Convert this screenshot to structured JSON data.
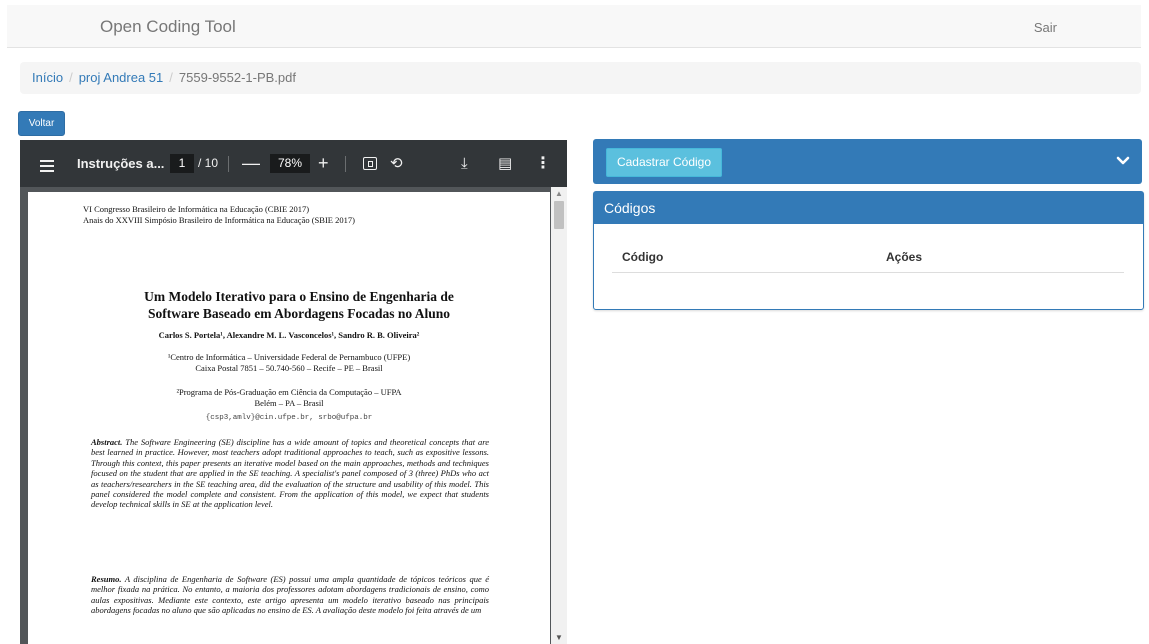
{
  "navbar": {
    "brand": "Open Coding Tool",
    "logout": "Sair"
  },
  "breadcrumb": {
    "home": "Início",
    "project": "proj Andrea 51",
    "file": "7559-9552-1-PB.pdf",
    "separator": "/"
  },
  "back_button": "Voltar",
  "pdf_viewer": {
    "title": "Instruções a...",
    "current_page": "1",
    "total_pages": "/ 10",
    "zoom": "78%",
    "zoom_out": "—",
    "zoom_in": "+",
    "icons": [
      "menu-icon",
      "fit-page-icon",
      "rotate-icon",
      "download-icon",
      "print-icon",
      "more-icon"
    ],
    "page": {
      "header_line1": "VI Congresso Brasileiro de Informática na Educação (CBIE 2017)",
      "header_line2": "Anais do XXVIII Simpósio Brasileiro de Informática na Educação (SBIE 2017)",
      "title_line1": "Um Modelo Iterativo para o Ensino de Engenharia de",
      "title_line2": "Software Baseado em Abordagens Focadas no Aluno",
      "authors": "Carlos S. Portela¹, Alexandre M. L. Vasconcelos¹, Sandro R. B. Oliveira²",
      "affil1_line1": "¹Centro de Informática – Universidade Federal de Pernambuco (UFPE)",
      "affil1_line2": "Caixa Postal 7851 – 50.740-560 – Recife – PE – Brasil",
      "affil2_line1": "²Programa de Pós-Graduação em Ciência da Computação – UFPA",
      "affil2_line2": "Belém – PA – Brasil",
      "emails": "{csp3,amlv}@cin.ufpe.br, srbo@ufpa.br",
      "abstract_label": "Abstract.",
      "abstract_text": "The Software Engineering (SE) discipline has a wide amount of topics and theoretical concepts that are best learned in practice. However, most teachers adopt traditional approaches to teach, such as expositive lessons. Through this context, this paper presents an iterative model based on the main approaches, methods and techniques focused on the student that are applied in the SE teaching. A specialist's panel composed of 3 (three) PhDs who act as teachers/researchers in the SE teaching area, did the evaluation of the structure and usability of this model. This panel considered the model complete and consistent. From the application of this model, we expect that students develop technical skills in SE at the application level.",
      "resumo_label": "Resumo.",
      "resumo_text": "A disciplina de Engenharia de Software (ES) possui uma ampla quantidade de tópicos teóricos que é melhor fixada na prática. No entanto, a maioria dos professores adotam abordagens tradicionais de ensino, como aulas expositivas. Mediante este contexto, este artigo apresenta um modelo iterativo baseado nas principais abordagens focadas no aluno que são aplicadas no ensino de ES. A avaliação deste modelo foi feita através de um"
    }
  },
  "code_panel": {
    "add_button": "Cadastrar Código",
    "heading": "Códigos",
    "columns": [
      "Código",
      "Ações"
    ]
  },
  "colors": {
    "primary": "#337ab7",
    "info": "#5bc0de",
    "toolbar": "#323639",
    "viewer_bg": "#525659"
  }
}
